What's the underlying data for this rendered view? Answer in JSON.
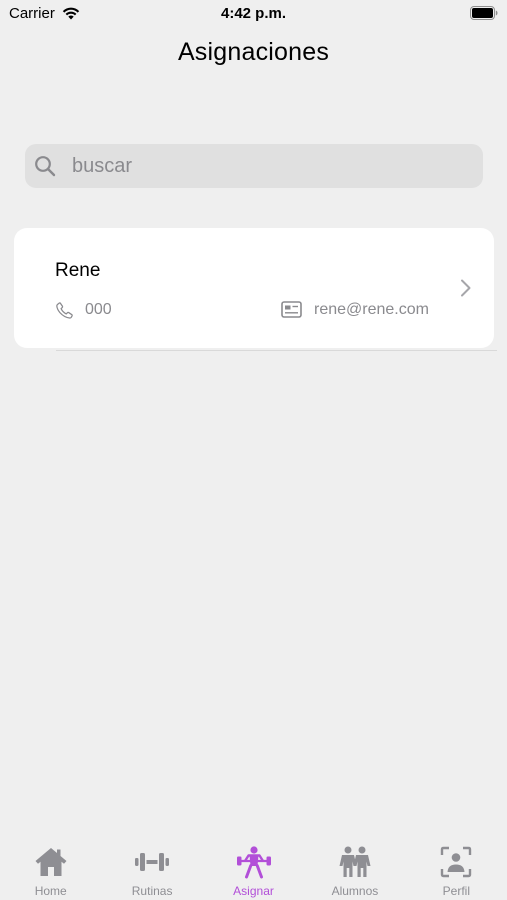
{
  "status_bar": {
    "carrier": "Carrier",
    "time": "4:42 p.m."
  },
  "header": {
    "title": "Asignaciones"
  },
  "search": {
    "placeholder": "buscar",
    "value": ""
  },
  "list": [
    {
      "name": "Rene",
      "phone": "000",
      "email": "rene@rene.com"
    }
  ],
  "tabs": [
    {
      "label": "Home",
      "icon": "home-icon",
      "active": false
    },
    {
      "label": "Rutinas",
      "icon": "dumbbell-icon",
      "active": false
    },
    {
      "label": "Asignar",
      "icon": "weightlifter-icon",
      "active": true
    },
    {
      "label": "Alumnos",
      "icon": "people-icon",
      "active": false
    },
    {
      "label": "Perfil",
      "icon": "profile-icon",
      "active": false
    }
  ],
  "colors": {
    "background": "#efefef",
    "accent": "#b24fd8",
    "inactive": "#8e8e93",
    "secondary_text": "#8a8a8e"
  }
}
